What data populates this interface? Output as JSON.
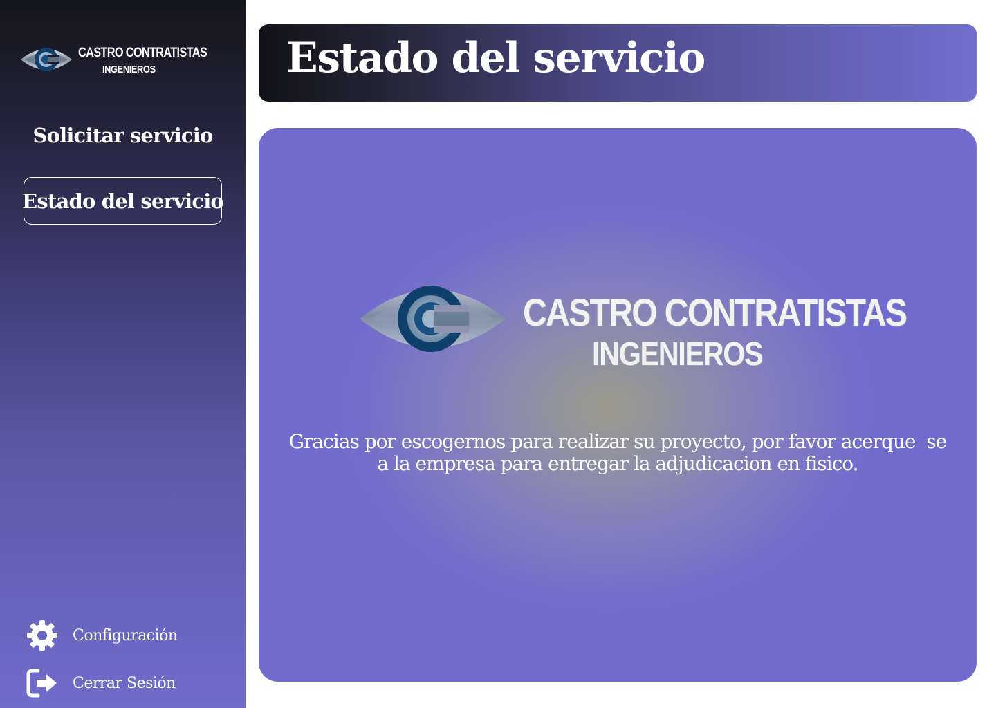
{
  "sidebar": {
    "brand": {
      "name": "CASTRO CONTRATISTAS",
      "subtitle": "INGENIEROS",
      "logo_icon": "eye-c-logo-icon"
    },
    "nav": [
      {
        "label": "Solicitar servicio",
        "active": false
      },
      {
        "label": "Estado del servicio",
        "active": true
      }
    ],
    "bottom": [
      {
        "label": "Configuración",
        "icon": "gear-icon"
      },
      {
        "label": "Cerrar Sesión",
        "icon": "logout-icon"
      }
    ]
  },
  "header": {
    "title": "Estado del servicio"
  },
  "card": {
    "logo": {
      "name": "CASTRO CONTRATISTAS",
      "subtitle": "INGENIEROS"
    },
    "message_lines": [
      "Gracias por escogernos para realizar su proyecto, por favor acerque  se",
      "a la empresa para entregar la adjudicacion en fisico."
    ]
  },
  "colors": {
    "sidebar_top": "#15151c",
    "sidebar_bottom": "#6f6dca",
    "accent": "#706ccd",
    "card_center": "#9a9a8a",
    "text": "#ffffff"
  }
}
